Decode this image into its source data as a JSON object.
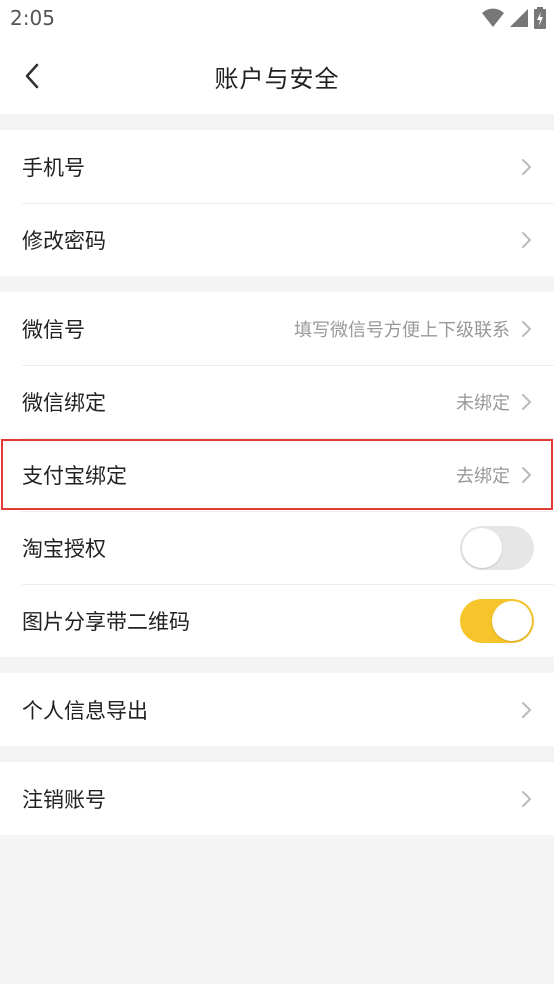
{
  "status_bar": {
    "time": "2:05"
  },
  "header": {
    "title": "账户与安全"
  },
  "groups": [
    {
      "items": [
        {
          "label": "手机号",
          "value": ""
        },
        {
          "label": "修改密码",
          "value": ""
        }
      ]
    },
    {
      "items": [
        {
          "label": "微信号",
          "value": "填写微信号方便上下级联系"
        },
        {
          "label": "微信绑定",
          "value": "未绑定"
        },
        {
          "label": "支付宝绑定",
          "value": "去绑定"
        },
        {
          "label": "淘宝授权",
          "toggle": false
        },
        {
          "label": "图片分享带二维码",
          "toggle": true
        }
      ]
    },
    {
      "items": [
        {
          "label": "个人信息导出",
          "value": ""
        }
      ]
    },
    {
      "items": [
        {
          "label": "注销账号",
          "value": ""
        }
      ]
    }
  ],
  "colors": {
    "accent": "#f6c52b",
    "highlight_box": "#e53935",
    "background": "#f4f4f4"
  },
  "icons": [
    "back-arrow-icon",
    "wifi-icon",
    "signal-icon",
    "battery-icon",
    "chevron-right-icon"
  ]
}
